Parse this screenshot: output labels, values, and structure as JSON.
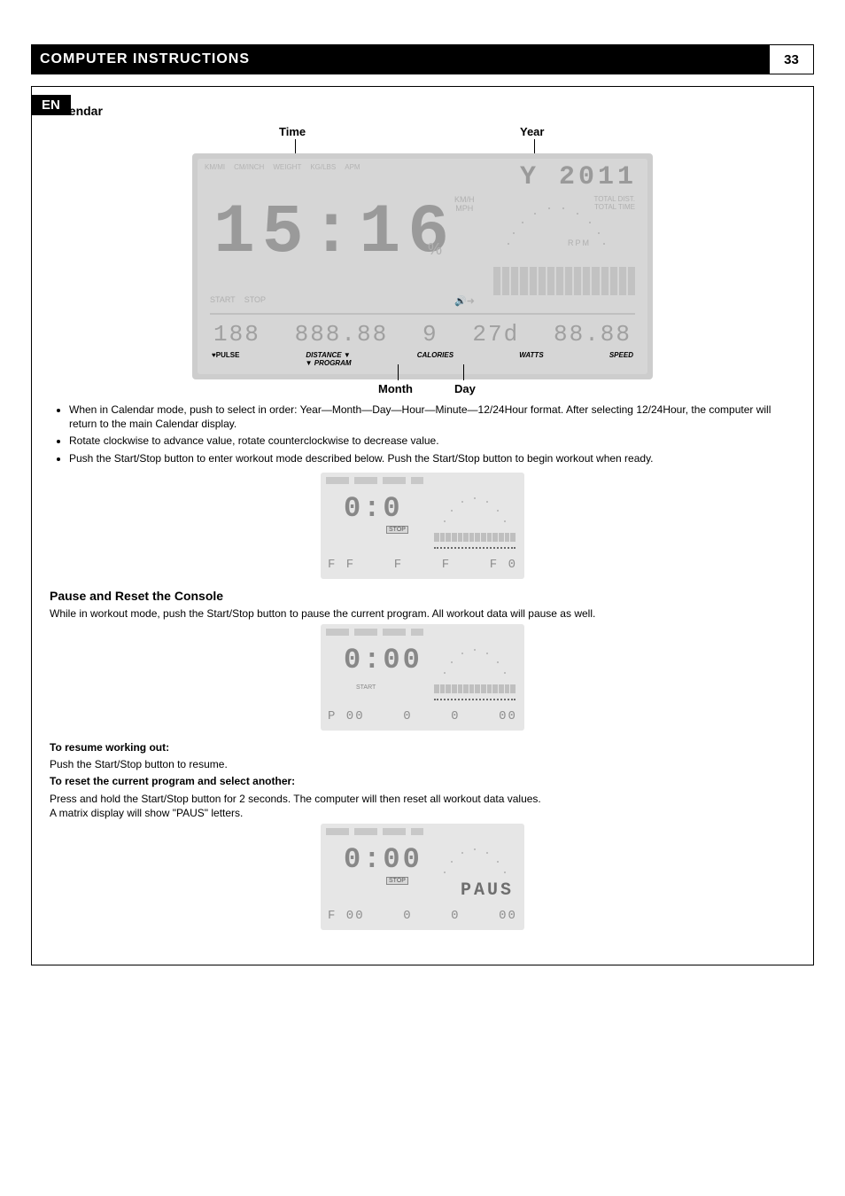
{
  "header": {
    "title": "COMPUTER INSTRUCTIONS",
    "page_number": "33",
    "language": "EN"
  },
  "section_calendar": {
    "title": "Calendar",
    "big_display": {
      "ann_time": "Time",
      "ann_year": "Year",
      "ann_month": "Month",
      "ann_day": "Day",
      "big_time": "15:16",
      "year": "Y 2011",
      "bottom_month": "9",
      "bottom_day": "27d",
      "top_labels": {
        "a": "KM/MI",
        "b": "CM/INCH",
        "c": "WEIGHT",
        "d": "KG/LBS",
        "e": "APM",
        "f": "TOTAL DIST.",
        "g": "TOTAL TIME"
      },
      "kmh": "KM/H\nMPH",
      "rpm": "RPM",
      "percent": "%",
      "label_pulse": "♥PULSE",
      "label_distance": "DISTANCE ▼\n▼ PROGRAM",
      "label_calories": "CALORIES",
      "label_watts": "WATTS",
      "label_speed": "SPEED",
      "start": "START",
      "stop": "STOP"
    },
    "bullets": [
      "When in Calendar mode, push to select in order: Year—Month—Day—Hour—Minute—12/24Hour format. After selecting 12/24Hour, the computer will return to the main Calendar display.",
      "Rotate clockwise to advance value, rotate counterclockwise to decrease value.",
      "Push the Start/Stop button to enter workout mode described below. Push the Start/Stop button to begin workout when ready."
    ]
  },
  "small_fig1": {
    "big": "0:0",
    "stop": "STOP",
    "bot_left": "F F",
    "bot_mid": "F",
    "bot_r1": "F",
    "bot_r2": "F 0"
  },
  "section_pause": {
    "title": "Pause and Reset the Console",
    "intro": "While in workout mode, push the Start/Stop button to pause the current program. All workout data will pause as well.",
    "fig": {
      "big": "0:00",
      "start": "START",
      "bot_left": "P  00",
      "bot_mid": "0",
      "bot_r1": "0",
      "bot_r2": "00"
    },
    "to_resume_title": "To resume working out:",
    "to_resume": "Push the Start/Stop button to resume.",
    "to_reset_title": "To reset the current program and select another:",
    "to_reset_body": "Press and hold the Start/Stop button for 2 seconds. The computer will then reset all workout data values.\nA matrix display will show \"PAUS\" letters.",
    "fig_paus": {
      "big": "0:00",
      "stop": "STOP",
      "paus": "PAUS",
      "bot_left": "F  00",
      "bot_mid": "0",
      "bot_r1": "0",
      "bot_r2": "00"
    }
  }
}
